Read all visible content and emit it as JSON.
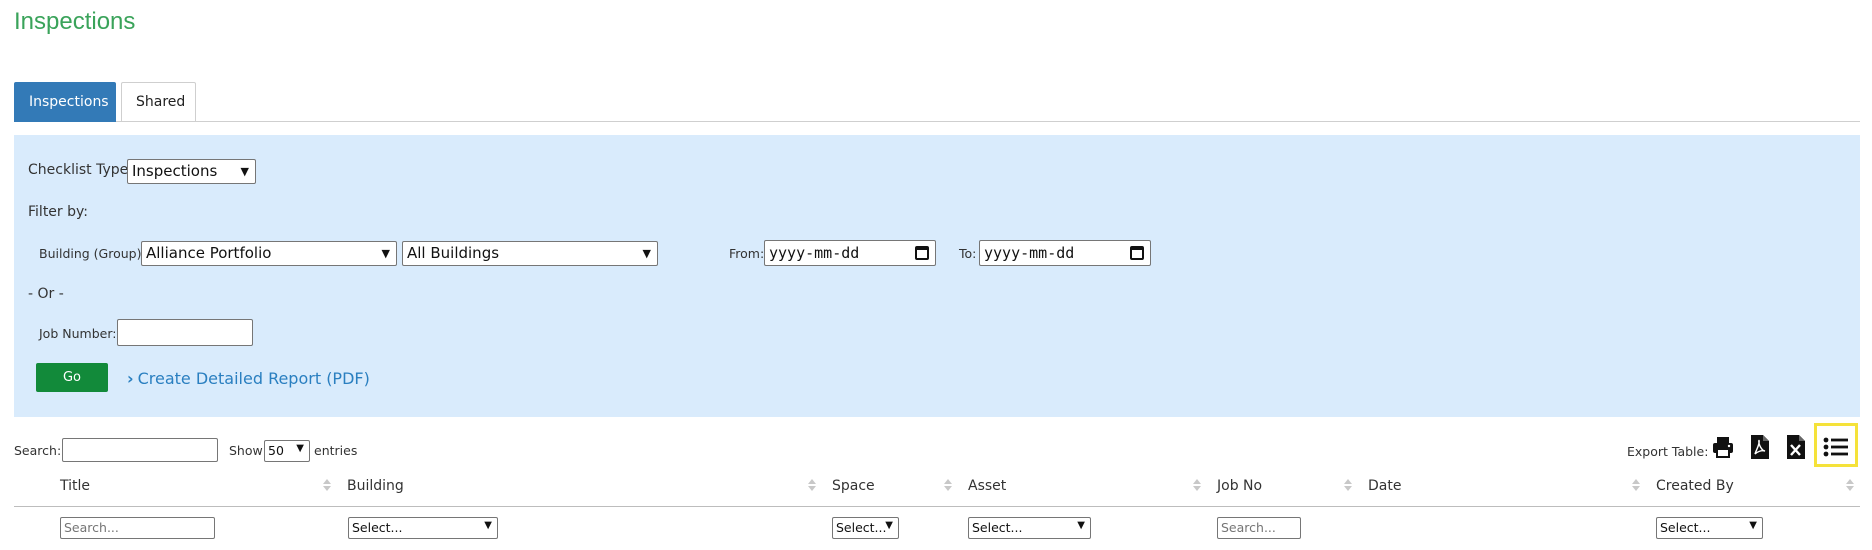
{
  "page": {
    "title": "Inspections"
  },
  "tabs": [
    {
      "label": "Inspections",
      "active": true
    },
    {
      "label": "Shared",
      "active": false
    }
  ],
  "filters": {
    "checklist_type_label": "Checklist Type:",
    "checklist_type_value": "Inspections",
    "filter_by_label": "Filter by:",
    "building_group_label": "Building (Group):",
    "building_group_value": "Alliance Portfolio",
    "building_value": "All Buildings",
    "from_label": "From:",
    "from_placeholder": "yyyy-mm-dd",
    "to_label": "To:",
    "to_placeholder": "yyyy-mm-dd",
    "or_label": "- Or -",
    "job_number_label": "Job Number:",
    "job_number_value": "",
    "go_label": "Go",
    "report_link_label": "Create Detailed Report (PDF)"
  },
  "table_controls": {
    "search_label": "Search:",
    "search_value": "",
    "show_label": "Show",
    "entries_value": "50",
    "entries_label": "entries",
    "export_label": "Export Table:",
    "export_icons": [
      "print-icon",
      "pdf-icon",
      "excel-icon",
      "column-list-icon"
    ]
  },
  "table": {
    "columns": [
      "Title",
      "Building",
      "Space",
      "Asset",
      "Job No",
      "Date",
      "Created By"
    ],
    "column_filters": [
      {
        "type": "search",
        "placeholder": "Search..."
      },
      {
        "type": "select",
        "value": "Select..."
      },
      {
        "type": "select",
        "value": "Select..."
      },
      {
        "type": "select",
        "value": "Select..."
      },
      {
        "type": "search",
        "placeholder": "Search..."
      },
      {
        "type": "none"
      },
      {
        "type": "select",
        "value": "Select..."
      }
    ]
  },
  "colors": {
    "title": "#3aa35a",
    "tab_active": "#337ab7",
    "panel_bg": "#d9ebfc",
    "go_button": "#128a3a",
    "link": "#2a7fc0",
    "highlight": "#f5e23a"
  }
}
